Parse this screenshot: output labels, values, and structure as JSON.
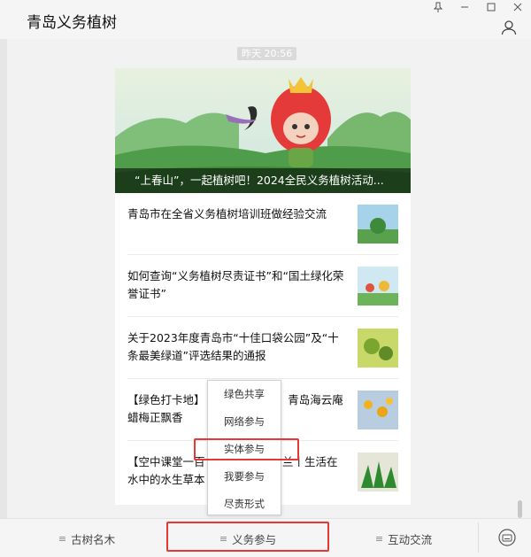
{
  "window": {
    "title": "青岛义务植树"
  },
  "window_controls": [
    "pin",
    "minimize",
    "maximize",
    "close"
  ],
  "chat": {
    "timestamp": "昨天 20:56"
  },
  "card": {
    "banner_caption": "“上春山”，一起植树吧！2024全民义务植树活动...",
    "articles": [
      {
        "title": "青岛市在全省义务植树培训班做经验交流"
      },
      {
        "title": "如何查询“义务植树尽责证书”和“国土绿化荣誉证书”"
      },
      {
        "title": "关于2023年度青岛市“十佳口袋公园”及“十条最美绿道”评选结果的通报"
      },
      {
        "title": "【绿色打卡地】　　　　　　时，青岛海云庵蜡梅正飘香"
      },
      {
        "title": "【空中课堂一百　　　　　　罗兰丨生活在水中的水生草本"
      }
    ]
  },
  "popup_menu": {
    "items": [
      "绿色共享",
      "网络参与",
      "实体参与",
      "我要参与",
      "尽责形式"
    ],
    "highlighted": "实体参与"
  },
  "bottom_tabs": [
    {
      "label": "古树名木"
    },
    {
      "label": "义务参与",
      "active": true
    },
    {
      "label": "互动交流"
    }
  ],
  "colors": {
    "highlight": "#e53935"
  }
}
